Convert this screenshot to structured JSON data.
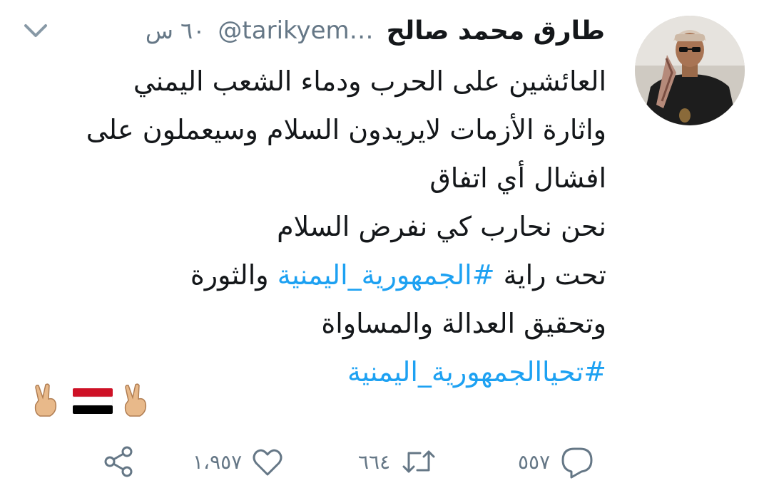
{
  "tweet": {
    "display_name": "طارق محمد صالح",
    "handle": "@tarikyem…",
    "time": "٦٠ س",
    "lines": [
      {
        "text": "العائشين على الحرب ودماء الشعب اليمني"
      },
      {
        "text": "واثارة الأزمات لايريدون السلام وسيعملون على"
      },
      {
        "text": "افشال أي اتفاق"
      },
      {
        "text": "نحن نحارب كي نفرض السلام"
      },
      {
        "pre": "تحت راية ",
        "hashtag": "#الجمهورية_اليمنية",
        "post": " والثورة"
      },
      {
        "text": "وتحقيق العدالة والمساواة"
      },
      {
        "hashtag": "#تحياالجمهورية_اليمنية"
      }
    ],
    "emoji": [
      "✌🏼",
      "🇾🇪",
      "✌🏼"
    ]
  },
  "actions": {
    "replies": "٥٥٧",
    "retweets": "٦٦٤",
    "likes": "١،٩٥٧"
  },
  "colors": {
    "link": "#1da1f2",
    "muted": "#657786",
    "text": "#14171a"
  },
  "icons": [
    "chevron-down-icon",
    "reply-icon",
    "retweet-icon",
    "like-icon",
    "share-icon"
  ]
}
